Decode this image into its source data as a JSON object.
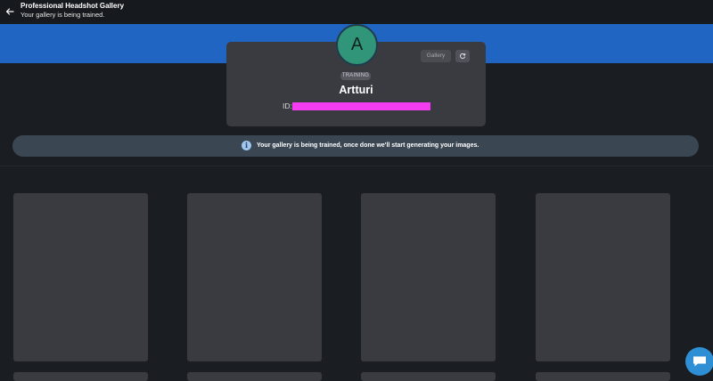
{
  "header": {
    "title": "Professional Headshot Gallery",
    "subtitle": "Your gallery is being trained."
  },
  "profile": {
    "avatar_initial": "A",
    "status": "TRAINING",
    "name": "Artturi",
    "id_label": "ID:"
  },
  "actions": {
    "gallery_label": "Gallery"
  },
  "notice": {
    "message": "Your gallery is being trained, once done we'll start generating your images."
  },
  "icons": {
    "back": "arrow-left-icon",
    "refresh": "refresh-icon",
    "info": "info-icon",
    "chat": "chat-icon"
  },
  "colors": {
    "background": "#1a1d21",
    "banner": "#2165c3",
    "card": "#393b41",
    "avatar": "#31957a",
    "redaction": "#f43df0",
    "chat_button": "#2e8fd4"
  }
}
